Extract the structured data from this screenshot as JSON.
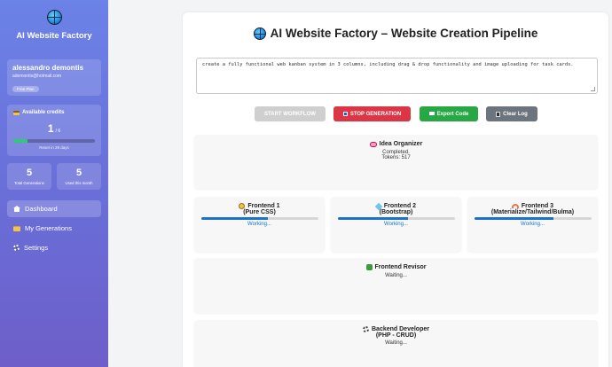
{
  "sidebar": {
    "brand_title": "AI Website Factory",
    "user": {
      "name": "alessandro demontis",
      "email": "ademontis@hotmail.com",
      "plan": "Free Plan"
    },
    "credits": {
      "label": "Available credits",
      "used": "1",
      "total": "/ 6",
      "fraction": 0.17,
      "reset": "Reset in 29 days"
    },
    "stats": [
      {
        "value": "5",
        "label": "Total Generations"
      },
      {
        "value": "5",
        "label": "Used this month"
      }
    ],
    "nav": [
      {
        "label": "Dashboard",
        "icon": "home-icon",
        "active": true
      },
      {
        "label": "My Generations",
        "icon": "folder-icon"
      },
      {
        "label": "Settings",
        "icon": "gear-icon"
      }
    ]
  },
  "main": {
    "title": "AI Website Factory – Website Creation Pipeline",
    "prompt": "create a fully functional web kanban system in 3 columns, including drag & drop functionality and image uploading for task cards.",
    "buttons": {
      "start": "START WORKFLOW",
      "stop": "STOP GENERATION",
      "export": "Export Code",
      "clear": "Clear Log"
    },
    "stages": {
      "idea": {
        "title": "Idea Organizer",
        "status": "Completed.",
        "tokens": "Tokens: 517"
      },
      "frontend1": {
        "title": "Frontend 1",
        "sub": "(Pure CSS)",
        "status": "Working...",
        "progress": 0.57
      },
      "frontend2": {
        "title": "Frontend 2",
        "sub": "(Bootstrap)",
        "status": "Working...",
        "progress": 0.6
      },
      "frontend3": {
        "title": "Frontend 3",
        "sub": "(Materialize/Tailwind/Bulma)",
        "status": "Working...",
        "progress": 0.68
      },
      "revisor": {
        "title": "Frontend Revisor",
        "status": "Waiting..."
      },
      "backend": {
        "title": "Backend Developer",
        "sub": "(PHP - CRUD)",
        "status": "Waiting..."
      }
    }
  },
  "colors": {
    "accent": "#1a73c8",
    "stop": "#dc3545",
    "export": "#28a745",
    "clear": "#6c757d"
  }
}
